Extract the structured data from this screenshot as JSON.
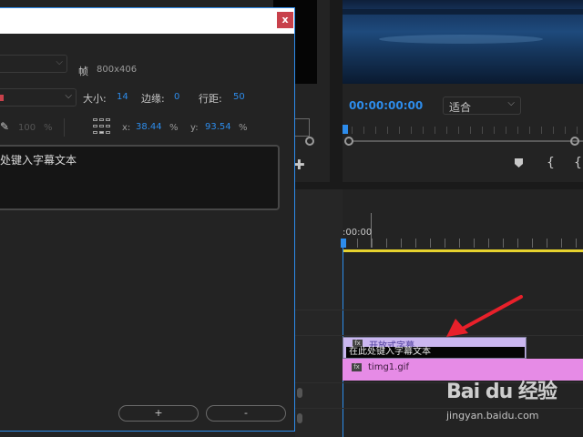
{
  "dialog": {
    "close_glyph": "x",
    "frame_label": "帧",
    "frame_value": "800x406",
    "size_label": "大小:",
    "size_value": "14",
    "edge_label": "边缘:",
    "edge_value": "0",
    "leading_label": "行距:",
    "leading_value": "50",
    "opacity_value": "100",
    "opacity_unit": "%",
    "x_label": "x:",
    "x_value": "38.44",
    "x_unit": "%",
    "y_label": "y:",
    "y_value": "93.54",
    "y_unit": "%",
    "caption_text": "处键入字幕文本",
    "add_button": "+",
    "remove_button": "-"
  },
  "program": {
    "timecode": "00:00:00:00",
    "fit_value": "适合"
  },
  "timeline": {
    "time_label": ":00:00",
    "title_clip_name": "开放式字幕",
    "title_clip_subtext": "在此处键入字幕文本",
    "gif_clip_name": "timg1.gif"
  },
  "watermark": {
    "logo": "Bai du 经验",
    "url": "jingyan.baidu.com"
  },
  "colors": {
    "accent_blue": "#2d8ceb",
    "title_clip": "#cbb7f0",
    "gif_clip": "#e68be6",
    "work_area": "#e6d22e",
    "close_red": "#c8414b",
    "arrow_red": "#e8202a"
  },
  "icons": {
    "close": "close-icon",
    "eyedropper": "eyedropper-icon",
    "align_grid": "align-grid-icon",
    "marker": "marker-icon",
    "in_brace": "in-point-icon",
    "out_brace": "out-point-icon",
    "mic": "mic-icon",
    "fx": "fx-badge-icon",
    "arrow": "red-arrow-annotation"
  }
}
